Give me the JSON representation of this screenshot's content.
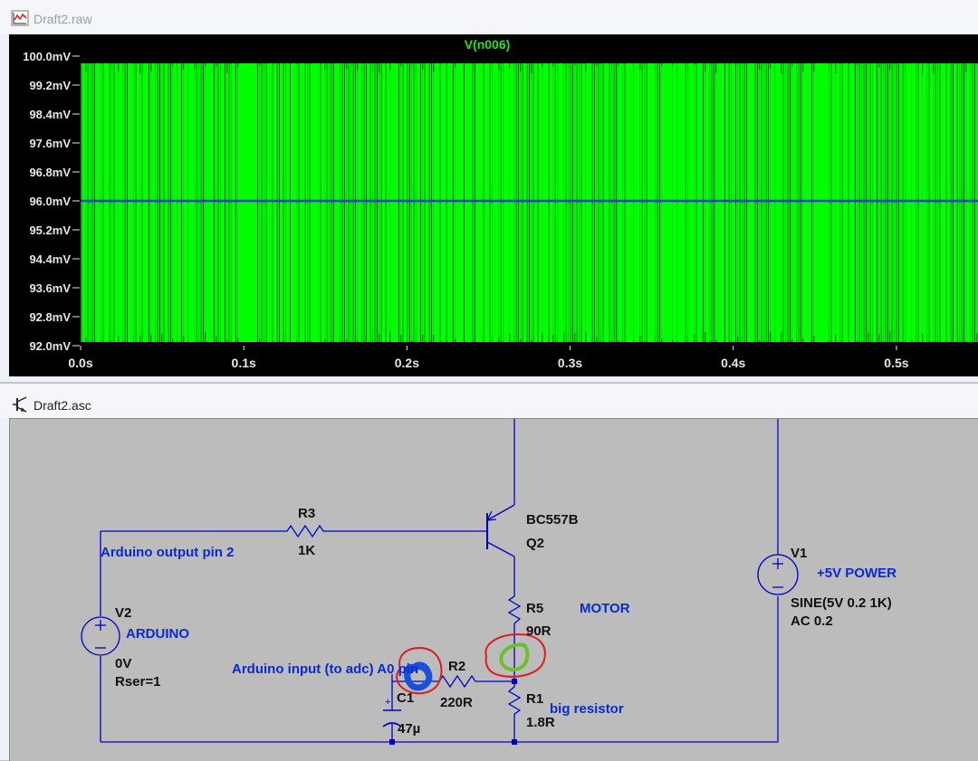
{
  "plot_window": {
    "title": "Draft2.raw",
    "icon": "waveform-icon",
    "trace_name": "V(n006)",
    "trace_color": "#00ff00",
    "mean_line_color": "#2a3adc",
    "background": "#000000",
    "y_ticks": [
      "100.0mV",
      "99.2mV",
      "98.4mV",
      "97.6mV",
      "96.8mV",
      "96.0mV",
      "95.2mV",
      "94.4mV",
      "93.6mV",
      "92.8mV",
      "92.0mV"
    ],
    "x_ticks": [
      "0.0s",
      "0.1s",
      "0.2s",
      "0.3s",
      "0.4s",
      "0.5s"
    ]
  },
  "chart_data": {
    "type": "line",
    "title": "V(n006)",
    "xlabel": "",
    "ylabel": "",
    "x_unit": "s",
    "y_unit": "mV",
    "xlim": [
      0.0,
      0.55
    ],
    "ylim": [
      92.0,
      100.0
    ],
    "grid": false,
    "series": [
      {
        "name": "V(n006)",
        "description_values": {
          "min": 92.0,
          "max": 100.0,
          "mean": 96.0
        }
      }
    ]
  },
  "schematic_window": {
    "title": "Draft2.asc",
    "icon": "transistor-icon",
    "wire_color": "#0000cc",
    "components": {
      "r3": {
        "ref": "R3",
        "value": "1K"
      },
      "q2": {
        "ref": "Q2",
        "model": "BC557B"
      },
      "r5": {
        "ref": "R5",
        "value": "90R"
      },
      "r2": {
        "ref": "R2",
        "value": "220R"
      },
      "r1": {
        "ref": "R1",
        "value": "1.8R"
      },
      "c1": {
        "ref": "C1",
        "value": "47µ"
      },
      "v1": {
        "ref": "V1",
        "value": "SINE(5V 0.2 1K)",
        "ac": "AC 0.2"
      },
      "v2": {
        "ref": "V2",
        "value": "0V",
        "rser": "Rser=1"
      }
    },
    "net_labels": {
      "arduino_output": "Arduino output pin 2",
      "arduino": "ARDUINO",
      "arduino_input": "Arduino input (to adc) A0 pin",
      "motor": "MOTOR",
      "power": "+5V POWER",
      "big_resistor": "big resistor"
    },
    "annotation_colors": {
      "red": "#dc1e1e",
      "blue": "#1a50d8",
      "green": "#6cc028"
    }
  }
}
